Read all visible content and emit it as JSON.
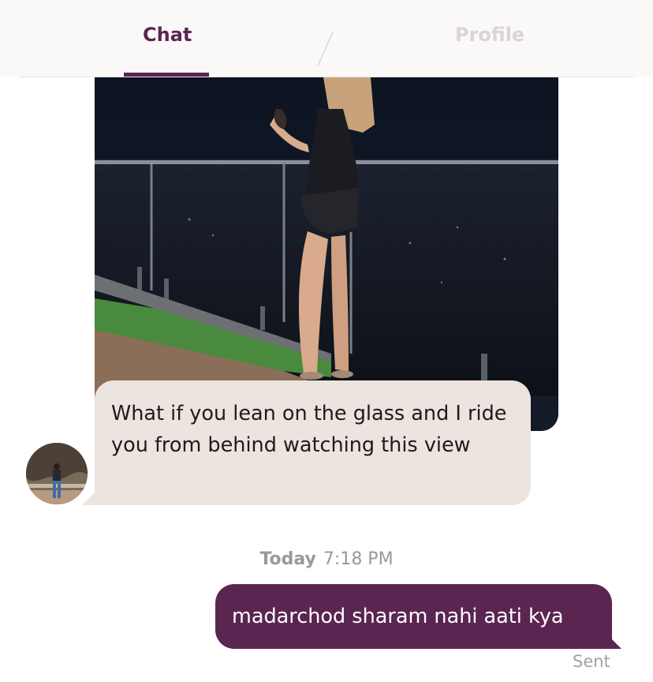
{
  "tabs": {
    "chat": "Chat",
    "profile": "Profile"
  },
  "messages": {
    "incoming_text": "What if you lean on the glass and I ride you from behind watching this view",
    "outgoing_text": "madarchod sharam nahi aati kya",
    "outgoing_status": "Sent"
  },
  "timestamp": {
    "day": "Today",
    "time": "7:18 PM"
  },
  "colors": {
    "accent": "#5b2552",
    "incoming_bubble": "#ebe4df",
    "tab_inactive": "#d9d4d6",
    "timestamp": "#9c9799"
  }
}
